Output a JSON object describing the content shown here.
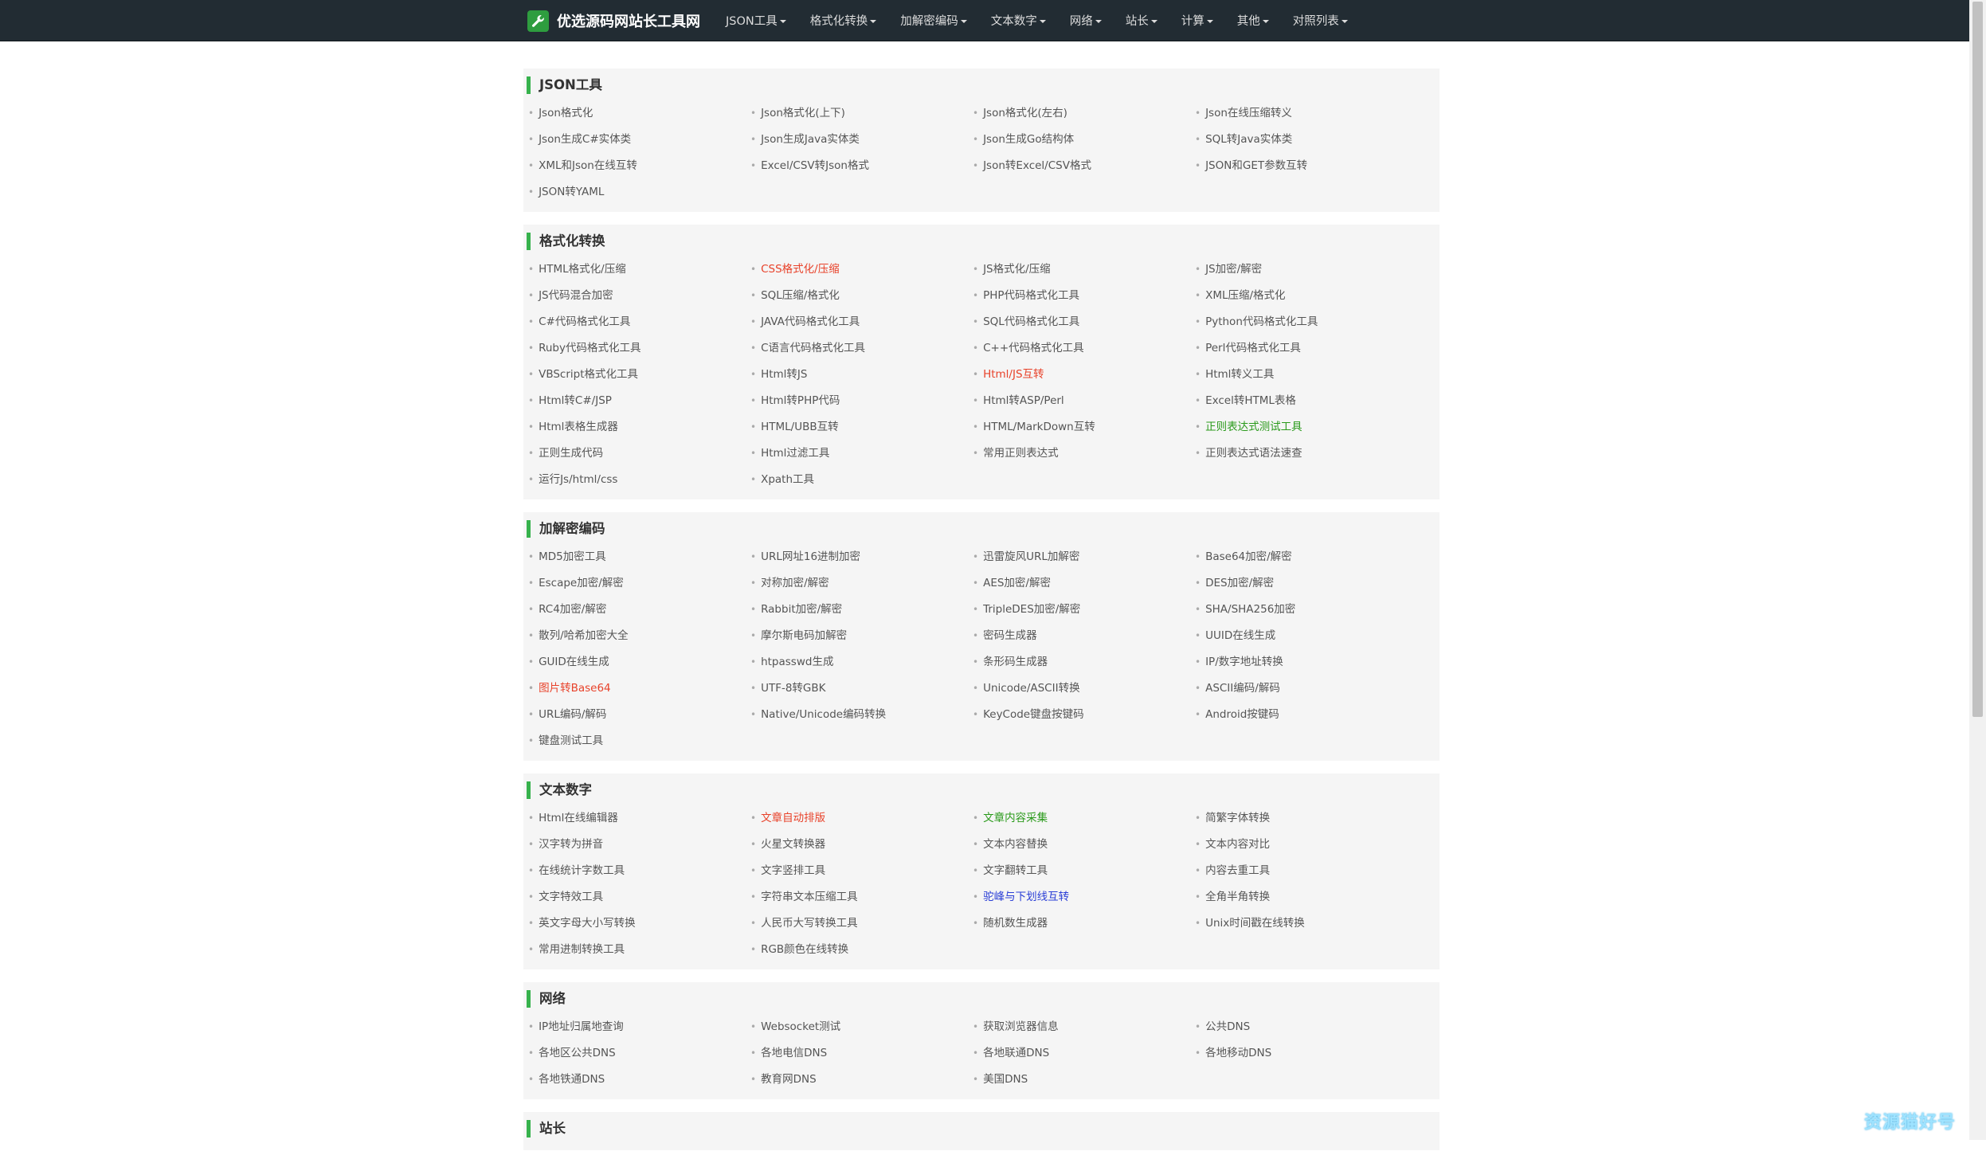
{
  "navbar": {
    "brand": "优选源码网站长工具网",
    "menu": [
      "JSON工具",
      "格式化转换",
      "加解密编码",
      "文本数字",
      "网络",
      "站长",
      "计算",
      "其他",
      "对照列表"
    ]
  },
  "sections": [
    {
      "title": "JSON工具",
      "items": [
        {
          "label": "Json格式化"
        },
        {
          "label": "Json格式化(上下)"
        },
        {
          "label": "Json格式化(左右)"
        },
        {
          "label": "Json在线压缩转义"
        },
        {
          "label": "Json生成C#实体类"
        },
        {
          "label": "Json生成Java实体类"
        },
        {
          "label": "Json生成Go结构体"
        },
        {
          "label": "SQL转Java实体类"
        },
        {
          "label": "XML和Json在线互转"
        },
        {
          "label": "Excel/CSV转Json格式"
        },
        {
          "label": "Json转Excel/CSV格式"
        },
        {
          "label": "JSON和GET参数互转"
        },
        {
          "label": "JSON转YAML"
        }
      ]
    },
    {
      "title": "格式化转换",
      "items": [
        {
          "label": "HTML格式化/压缩"
        },
        {
          "label": "CSS格式化/压缩",
          "color": "red"
        },
        {
          "label": "JS格式化/压缩"
        },
        {
          "label": "JS加密/解密"
        },
        {
          "label": "JS代码混合加密"
        },
        {
          "label": "SQL压缩/格式化"
        },
        {
          "label": "PHP代码格式化工具"
        },
        {
          "label": "XML压缩/格式化"
        },
        {
          "label": "C#代码格式化工具"
        },
        {
          "label": "JAVA代码格式化工具"
        },
        {
          "label": "SQL代码格式化工具"
        },
        {
          "label": "Python代码格式化工具"
        },
        {
          "label": "Ruby代码格式化工具"
        },
        {
          "label": "C语言代码格式化工具"
        },
        {
          "label": "C++代码格式化工具"
        },
        {
          "label": "Perl代码格式化工具"
        },
        {
          "label": "VBScript格式化工具"
        },
        {
          "label": "Html转JS"
        },
        {
          "label": "Html/JS互转",
          "color": "red"
        },
        {
          "label": "Html转义工具"
        },
        {
          "label": "Html转C#/JSP"
        },
        {
          "label": "Html转PHP代码"
        },
        {
          "label": "Html转ASP/Perl"
        },
        {
          "label": "Excel转HTML表格"
        },
        {
          "label": "Html表格生成器"
        },
        {
          "label": "HTML/UBB互转"
        },
        {
          "label": "HTML/MarkDown互转"
        },
        {
          "label": "正则表达式测试工具",
          "color": "green"
        },
        {
          "label": "正则生成代码"
        },
        {
          "label": "Html过滤工具"
        },
        {
          "label": "常用正则表达式"
        },
        {
          "label": "正则表达式语法速查"
        },
        {
          "label": "运行Js/html/css"
        },
        {
          "label": "Xpath工具"
        }
      ]
    },
    {
      "title": "加解密编码",
      "items": [
        {
          "label": "MD5加密工具"
        },
        {
          "label": "URL网址16进制加密"
        },
        {
          "label": "迅雷旋风URL加解密"
        },
        {
          "label": "Base64加密/解密"
        },
        {
          "label": "Escape加密/解密"
        },
        {
          "label": "对称加密/解密"
        },
        {
          "label": "AES加密/解密"
        },
        {
          "label": "DES加密/解密"
        },
        {
          "label": "RC4加密/解密"
        },
        {
          "label": "Rabbit加密/解密"
        },
        {
          "label": "TripleDES加密/解密"
        },
        {
          "label": "SHA/SHA256加密"
        },
        {
          "label": "散列/哈希加密大全"
        },
        {
          "label": "摩尔斯电码加解密"
        },
        {
          "label": "密码生成器"
        },
        {
          "label": "UUID在线生成"
        },
        {
          "label": "GUID在线生成"
        },
        {
          "label": "htpasswd生成"
        },
        {
          "label": "条形码生成器"
        },
        {
          "label": "IP/数字地址转换"
        },
        {
          "label": "图片转Base64",
          "color": "red"
        },
        {
          "label": "UTF-8转GBK"
        },
        {
          "label": "Unicode/ASCII转换"
        },
        {
          "label": "ASCII编码/解码"
        },
        {
          "label": "URL编码/解码"
        },
        {
          "label": "Native/Unicode编码转换"
        },
        {
          "label": "KeyCode键盘按键码"
        },
        {
          "label": "Android按键码"
        },
        {
          "label": "键盘测试工具"
        }
      ]
    },
    {
      "title": "文本数字",
      "items": [
        {
          "label": "Html在线编辑器"
        },
        {
          "label": "文章自动排版",
          "color": "red"
        },
        {
          "label": "文章内容采集",
          "color": "green"
        },
        {
          "label": "简繁字体转换"
        },
        {
          "label": "汉字转为拼音"
        },
        {
          "label": "火星文转换器"
        },
        {
          "label": "文本内容替换"
        },
        {
          "label": "文本内容对比"
        },
        {
          "label": "在线统计字数工具"
        },
        {
          "label": "文字竖排工具"
        },
        {
          "label": "文字翻转工具"
        },
        {
          "label": "内容去重工具"
        },
        {
          "label": "文字特效工具"
        },
        {
          "label": "字符串文本压缩工具"
        },
        {
          "label": "驼峰与下划线互转",
          "color": "blue"
        },
        {
          "label": "全角半角转换"
        },
        {
          "label": "英文字母大小写转换"
        },
        {
          "label": "人民币大写转换工具"
        },
        {
          "label": "随机数生成器"
        },
        {
          "label": "Unix时间戳在线转换"
        },
        {
          "label": "常用进制转换工具"
        },
        {
          "label": "RGB颜色在线转换"
        }
      ]
    },
    {
      "title": "网络",
      "items": [
        {
          "label": "IP地址归属地查询"
        },
        {
          "label": "Websocket测试"
        },
        {
          "label": "获取浏览器信息"
        },
        {
          "label": "公共DNS"
        },
        {
          "label": "各地区公共DNS"
        },
        {
          "label": "各地电信DNS"
        },
        {
          "label": "各地联通DNS"
        },
        {
          "label": "各地移动DNS"
        },
        {
          "label": "各地铁通DNS"
        },
        {
          "label": "教育网DNS"
        },
        {
          "label": "美国DNS"
        }
      ]
    },
    {
      "title": "站长",
      "items": []
    }
  ],
  "watermark": "资源猫好号"
}
